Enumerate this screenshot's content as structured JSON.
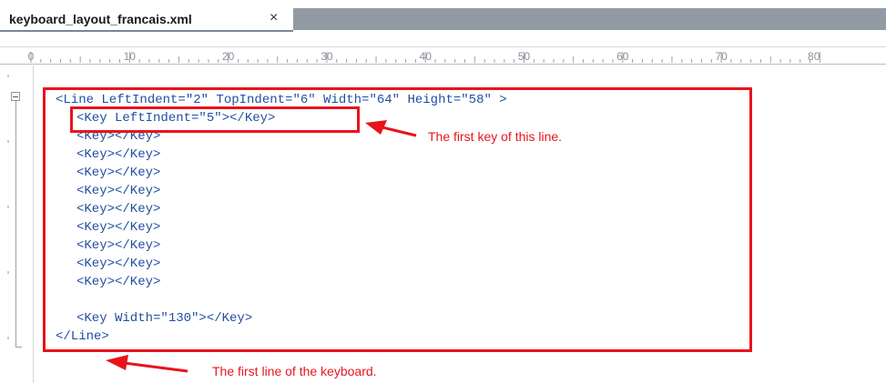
{
  "tab": {
    "title": "keyboard_layout_francais.xml",
    "close": "×"
  },
  "ruler": {
    "labels": [
      "0",
      "10",
      "20",
      "30",
      "40",
      "50",
      "60",
      "70",
      "80"
    ]
  },
  "code": {
    "line_open": "<Line LeftIndent=\"2\" TopIndent=\"6\" Width=\"64\" Height=\"58\" >",
    "key_first": "<Key LeftIndent=\"5\"></Key>",
    "keys": [
      "<Key></Key>",
      "<Key></Key>",
      "<Key></Key>",
      "<Key></Key>",
      "<Key></Key>",
      "<Key></Key>",
      "<Key></Key>",
      "<Key></Key>",
      "<Key></Key>"
    ],
    "key_last": "<Key Width=\"130\"></Key>",
    "line_close": "</Line>"
  },
  "annotations": {
    "first_key": "The first key of this line.",
    "first_line": "The first line of the keyboard."
  },
  "colors": {
    "highlight": "#e8141c",
    "code_text": "#1f4fa0",
    "tab_strip": "#929aa4"
  }
}
